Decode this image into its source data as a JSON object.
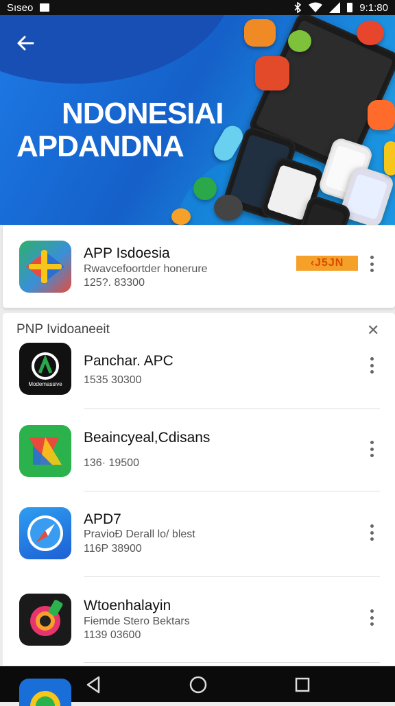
{
  "status_bar": {
    "carrier": "Sıseo",
    "time": "9:1:80"
  },
  "banner": {
    "title_line1": "NDONESIAI",
    "title_line2": "APDANDNA",
    "colors": {
      "top": "#1560c9",
      "bottom": "#2aa5ea"
    }
  },
  "featured_app": {
    "name": "APP Isdoesia",
    "subtitle": "Rwavcefoortder honerure",
    "size": "125?. 83300",
    "price_label": "‹J5JN",
    "icon": "map-compass-icon"
  },
  "section": {
    "title": "PNP Ividoaneeit",
    "apps": [
      {
        "name": "Panchar. APC",
        "subtitle": "",
        "size": "1535 30300",
        "icon_label": "Modemassive",
        "icon": "dark-a-logo-icon"
      },
      {
        "name": "Beaincyeal,Cdisans",
        "subtitle": "",
        "size": "136· 19500",
        "icon_label": "",
        "icon": "colorful-x-icon"
      },
      {
        "name": "APD7",
        "subtitle": "PravioĐ Derall lo/ blest",
        "size": "116P 38900",
        "icon_label": "",
        "icon": "compass-icon"
      },
      {
        "name": "Wtoenhalayin",
        "subtitle": "Fiemde Stero Bektars",
        "size": "1139 03600",
        "icon_label": "",
        "icon": "camera-lens-icon"
      }
    ]
  },
  "nav": {
    "back": "back-triangle-icon",
    "home": "home-circle-icon",
    "recents": "recents-square-icon"
  }
}
